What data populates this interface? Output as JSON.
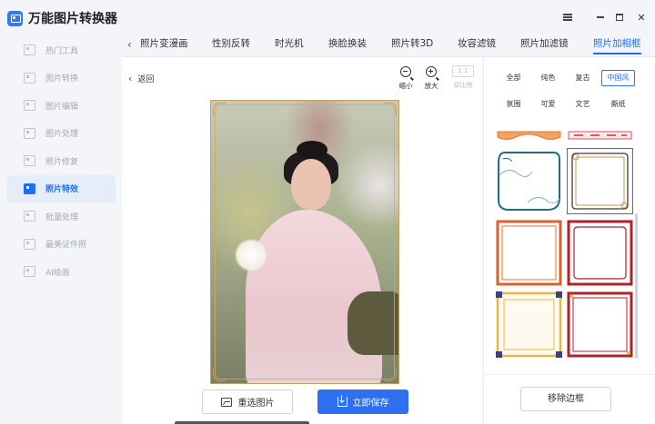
{
  "app": {
    "title": "万能图片转换器"
  },
  "sidebar": {
    "items": [
      {
        "label": "热门工具",
        "icon": "fire-icon",
        "active": false
      },
      {
        "label": "图片转换",
        "icon": "convert-icon",
        "active": false
      },
      {
        "label": "图片编辑",
        "icon": "edit-icon",
        "active": false
      },
      {
        "label": "图片处理",
        "icon": "process-icon",
        "active": false
      },
      {
        "label": "照片修复",
        "icon": "repair-icon",
        "active": false
      },
      {
        "label": "照片特效",
        "icon": "effects-icon",
        "active": true
      },
      {
        "label": "批量处理",
        "icon": "batch-icon",
        "active": false
      },
      {
        "label": "最美证件照",
        "icon": "id-photo-icon",
        "active": false
      },
      {
        "label": "AI绘画",
        "icon": "ai-paint-icon",
        "active": false
      }
    ]
  },
  "tabs": [
    {
      "label": "照片变漫画",
      "active": false
    },
    {
      "label": "性别反转",
      "active": false
    },
    {
      "label": "时光机",
      "active": false
    },
    {
      "label": "换脸换装",
      "active": false
    },
    {
      "label": "照片转3D",
      "active": false
    },
    {
      "label": "妆容滤镜",
      "active": false
    },
    {
      "label": "照片加滤镜",
      "active": false
    },
    {
      "label": "照片加相框",
      "active": true
    }
  ],
  "main": {
    "back_label": "返回",
    "zoom_out_label": "缩小",
    "zoom_in_label": "放大",
    "ratio_box": "1:1",
    "ratio_label": "原比例",
    "reselect_label": "重选图片",
    "save_label": "立即保存"
  },
  "right": {
    "filters_row1": [
      "全部",
      "纯色",
      "复古",
      "中国风"
    ],
    "filters_row2": [
      "氛围",
      "可爱",
      "文艺",
      "撕纸"
    ],
    "active_filter": "中国风",
    "remove_label": "移除边框"
  },
  "colors": {
    "accent": "#2f6ff2"
  }
}
